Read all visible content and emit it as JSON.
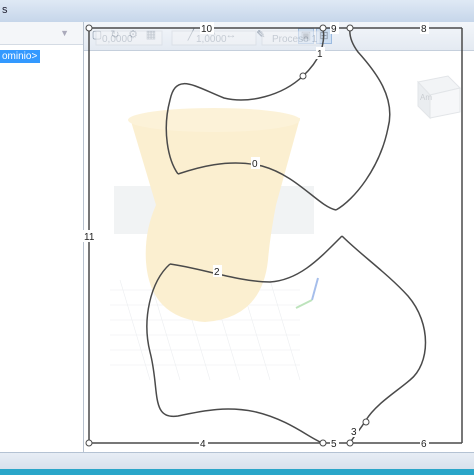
{
  "window": {
    "title_fragment": "s",
    "toolbar": {
      "coord_field": "0,0000",
      "scale_field": "1,0000",
      "phase_field": "Proceso 1"
    }
  },
  "tree": {
    "selected_item": "ominio>"
  },
  "sketch": {
    "edge_labels": [
      "0",
      "1",
      "2",
      "3",
      "4",
      "5",
      "6",
      "8",
      "9",
      "10",
      "11"
    ]
  },
  "viewcube": {
    "label": "Am"
  },
  "colors": {
    "stroke": "#4a4a4a",
    "highlight": "#3399ff",
    "ghost_solid": "#f5d27a"
  }
}
